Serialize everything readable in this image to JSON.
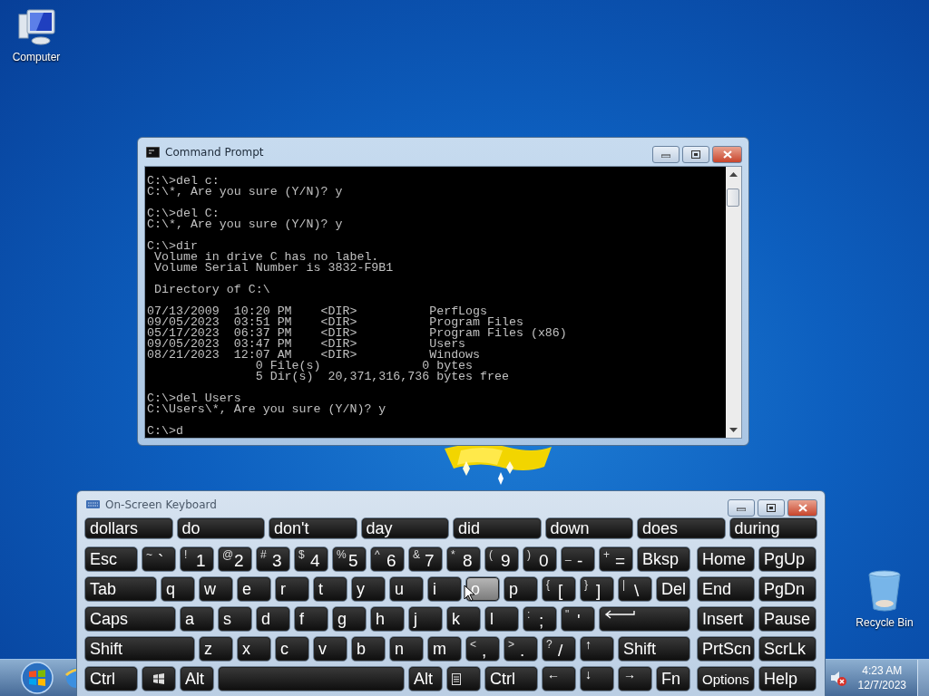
{
  "desktop_icons": [
    {
      "label": "Computer",
      "kind": "computer"
    },
    {
      "label": "Recycle Bin",
      "kind": "recycle"
    }
  ],
  "command_prompt": {
    "title": "Command Prompt",
    "blocks": [
      [
        "C:\\>del c:",
        "C:\\*, Are you sure (Y/N)? y"
      ],
      [
        "C:\\>del C:",
        "C:\\*, Are you sure (Y/N)? y"
      ],
      [
        "C:\\>dir",
        " Volume in drive C has no label.",
        " Volume Serial Number is 3832-F9B1"
      ],
      [
        " Directory of C:\\"
      ],
      [
        "07/13/2009  10:20 PM    <DIR>          PerfLogs",
        "09/05/2023  03:51 PM    <DIR>          Program Files",
        "05/17/2023  06:37 PM    <DIR>          Program Files (x86)",
        "09/05/2023  03:47 PM    <DIR>          Users",
        "08/21/2023  12:07 AM    <DIR>          Windows",
        "               0 File(s)              0 bytes",
        "               5 Dir(s)  20,371,316,736 bytes free"
      ],
      [
        "C:\\>del Users",
        "C:\\Users\\*, Are you sure (Y/N)? y"
      ],
      [
        "C:\\>d"
      ]
    ]
  },
  "keyboard": {
    "title": "On-Screen Keyboard",
    "suggestions": [
      "dollars",
      "do",
      "don't",
      "day",
      "did",
      "down",
      "does",
      "during"
    ],
    "rows": [
      {
        "keys": [
          {
            "label": "Esc",
            "kind": "small",
            "highlighted": false
          },
          {
            "top": "~",
            "label": "`",
            "kind": "pair",
            "highlighted": false
          },
          {
            "top": "!",
            "label": "1",
            "kind": "pair",
            "highlighted": false
          },
          {
            "top": "@",
            "label": "2",
            "kind": "pair",
            "highlighted": false
          },
          {
            "top": "#",
            "label": "3",
            "kind": "pair",
            "highlighted": false
          },
          {
            "top": "$",
            "label": "4",
            "kind": "pair",
            "highlighted": false
          },
          {
            "top": "%",
            "label": "5",
            "kind": "pair",
            "highlighted": false
          },
          {
            "top": "^",
            "label": "6",
            "kind": "pair",
            "highlighted": false
          },
          {
            "top": "&",
            "label": "7",
            "kind": "pair",
            "highlighted": false
          },
          {
            "top": "*",
            "label": "8",
            "kind": "pair",
            "highlighted": false
          },
          {
            "top": "(",
            "label": "9",
            "kind": "pair",
            "highlighted": false
          },
          {
            "top": ")",
            "label": "0",
            "kind": "pair",
            "highlighted": false
          },
          {
            "top": "_",
            "label": "-",
            "kind": "pair",
            "highlighted": false
          },
          {
            "top": "+",
            "label": "=",
            "kind": "pair",
            "highlighted": false
          },
          {
            "label": "Bksp",
            "kind": "small",
            "highlighted": false
          }
        ]
      },
      {
        "keys": [
          {
            "label": "Tab",
            "kind": "medium",
            "highlighted": false
          },
          {
            "label": "q",
            "kind": "key",
            "highlighted": false
          },
          {
            "label": "w",
            "kind": "key",
            "highlighted": false
          },
          {
            "label": "e",
            "kind": "key",
            "highlighted": false
          },
          {
            "label": "r",
            "kind": "key",
            "highlighted": false
          },
          {
            "label": "t",
            "kind": "key",
            "highlighted": false
          },
          {
            "label": "y",
            "kind": "key",
            "highlighted": false
          },
          {
            "label": "u",
            "kind": "key",
            "highlighted": false
          },
          {
            "label": "i",
            "kind": "key",
            "highlighted": false
          },
          {
            "label": "o",
            "kind": "key",
            "highlighted": true
          },
          {
            "label": "p",
            "kind": "key",
            "highlighted": false
          },
          {
            "top": "{",
            "label": "[",
            "kind": "pair",
            "highlighted": false
          },
          {
            "top": "}",
            "label": "]",
            "kind": "pair",
            "highlighted": false
          },
          {
            "top": "|",
            "label": "\\",
            "kind": "pair",
            "highlighted": false
          },
          {
            "label": "Del",
            "kind": "key",
            "highlighted": false
          }
        ]
      },
      {
        "keys": [
          {
            "label": "Caps",
            "kind": "large",
            "highlighted": false
          },
          {
            "label": "a",
            "kind": "key",
            "highlighted": false
          },
          {
            "label": "s",
            "kind": "key",
            "highlighted": false
          },
          {
            "label": "d",
            "kind": "key",
            "highlighted": false
          },
          {
            "label": "f",
            "kind": "key",
            "highlighted": false
          },
          {
            "label": "g",
            "kind": "key",
            "highlighted": false
          },
          {
            "label": "h",
            "kind": "key",
            "highlighted": false
          },
          {
            "label": "j",
            "kind": "key",
            "highlighted": false
          },
          {
            "label": "k",
            "kind": "key",
            "highlighted": false
          },
          {
            "label": "l",
            "kind": "key",
            "highlighted": false
          },
          {
            "top": ":",
            "label": ";",
            "kind": "pair",
            "highlighted": false
          },
          {
            "top": "\"",
            "label": "'",
            "kind": "pair",
            "highlighted": false
          },
          {
            "kind": "enter",
            "highlighted": false
          }
        ]
      },
      {
        "keys": [
          {
            "label": "Shift",
            "kind": "xlarge",
            "highlighted": false
          },
          {
            "label": "z",
            "kind": "key",
            "highlighted": false
          },
          {
            "label": "x",
            "kind": "key",
            "highlighted": false
          },
          {
            "label": "c",
            "kind": "key",
            "highlighted": false
          },
          {
            "label": "v",
            "kind": "key",
            "highlighted": false
          },
          {
            "label": "b",
            "kind": "key",
            "highlighted": false
          },
          {
            "label": "n",
            "kind": "key",
            "highlighted": false
          },
          {
            "label": "m",
            "kind": "key",
            "highlighted": false
          },
          {
            "top": "<",
            "label": ",",
            "kind": "pair",
            "highlighted": false
          },
          {
            "top": ">",
            "label": ".",
            "kind": "pair",
            "highlighted": false
          },
          {
            "top": "?",
            "label": "/",
            "kind": "pair",
            "highlighted": false
          },
          {
            "label": "↑",
            "kind": "arrow",
            "highlighted": false
          },
          {
            "label": "Shift",
            "kind": "medium",
            "highlighted": false
          }
        ]
      },
      {
        "keys": [
          {
            "label": "Ctrl",
            "kind": "small",
            "highlighted": false
          },
          {
            "kind": "winkey",
            "highlighted": false
          },
          {
            "label": "Alt",
            "kind": "key",
            "highlighted": false
          },
          {
            "kind": "space",
            "highlighted": false
          },
          {
            "label": "Alt",
            "kind": "key",
            "highlighted": false
          },
          {
            "kind": "menukey",
            "highlighted": false
          },
          {
            "label": "Ctrl",
            "kind": "small",
            "highlighted": false
          },
          {
            "label": "←",
            "kind": "arrow",
            "highlighted": false
          },
          {
            "label": "↓",
            "kind": "arrow",
            "highlighted": false
          },
          {
            "label": "→",
            "kind": "arrow",
            "highlighted": false
          },
          {
            "label": "Fn",
            "kind": "key",
            "highlighted": false
          }
        ]
      }
    ],
    "nav_rows": [
      [
        "Home",
        "PgUp"
      ],
      [
        "End",
        "PgDn"
      ],
      [
        "Insert",
        "Pause"
      ],
      [
        "PrtScn",
        "ScrLk"
      ],
      [
        "Options",
        "Help"
      ]
    ]
  },
  "taskbar": {
    "volume_muted": true,
    "time": "4:23 AM",
    "date": "12/7/2023"
  }
}
